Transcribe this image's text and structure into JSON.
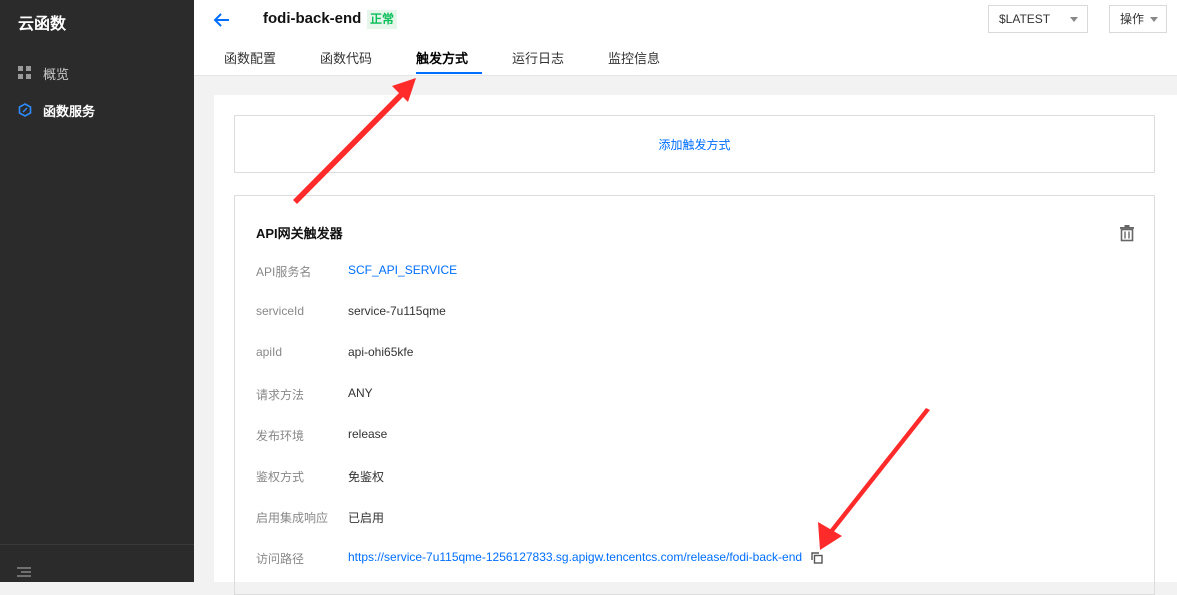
{
  "sidebar": {
    "brand": "云函数",
    "items": [
      {
        "label": "概览",
        "icon": "grid-icon",
        "active": false
      },
      {
        "label": "函数服务",
        "icon": "hexagon-icon",
        "active": true
      }
    ]
  },
  "header": {
    "function_name": "fodi-back-end",
    "status": "正常",
    "version": "$LATEST",
    "ops_label": "操作",
    "tabs": [
      {
        "label": "函数配置"
      },
      {
        "label": "函数代码"
      },
      {
        "label": "触发方式",
        "active": true
      },
      {
        "label": "运行日志"
      },
      {
        "label": "监控信息"
      }
    ]
  },
  "main": {
    "add_trigger": "添加触发方式",
    "trigger": {
      "title": "API网关触发器",
      "fields": [
        {
          "label": "API服务名",
          "value": "SCF_API_SERVICE"
        },
        {
          "label": "serviceId",
          "value": "service-7u115qme"
        },
        {
          "label": "apiId",
          "value": "api-ohi65kfe"
        },
        {
          "label": "请求方法",
          "value": "ANY"
        },
        {
          "label": "发布环境",
          "value": "release"
        },
        {
          "label": "鉴权方式",
          "value": "免鉴权"
        },
        {
          "label": "启用集成响应",
          "value": "已启用"
        },
        {
          "label": "访问路径",
          "value": "https://service-7u115qme-1256127833.sg.apigw.tencentcs.com/release/fodi-back-end"
        }
      ]
    }
  },
  "colors": {
    "accent": "#006eff",
    "status_green": "#0abf5b",
    "sidebar_bg": "#2b2b2b",
    "annotation_red": "#ff2a2a"
  }
}
